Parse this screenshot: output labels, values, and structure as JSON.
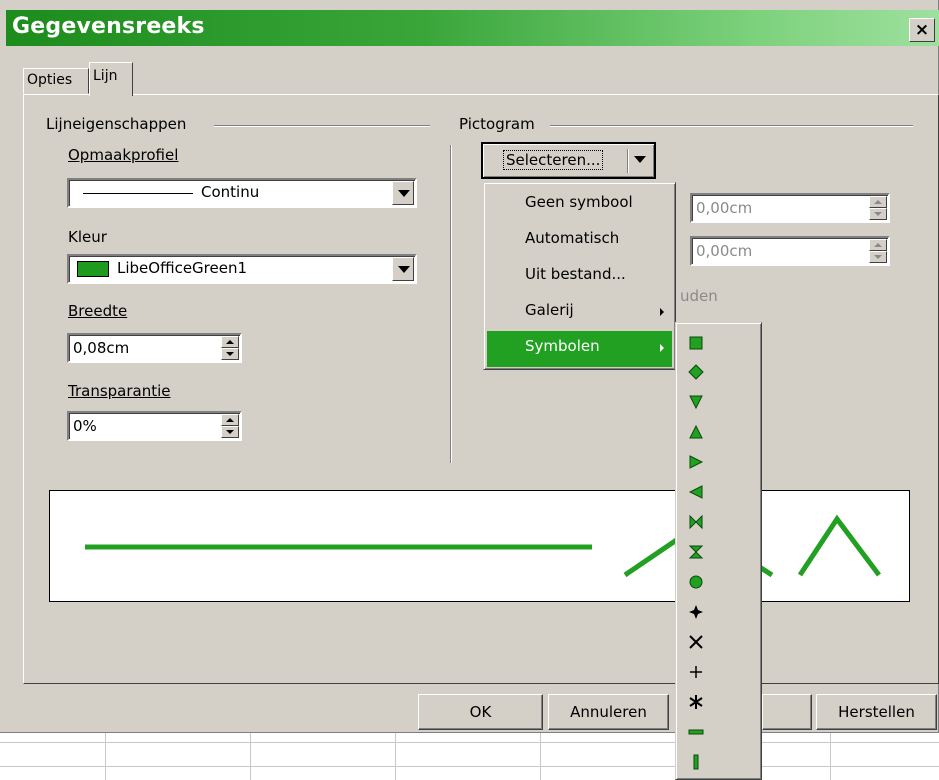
{
  "window": {
    "title": "Gegevensreeks",
    "close_glyph": "×"
  },
  "tabs": [
    {
      "label": "Opties"
    },
    {
      "label": "Lijn",
      "active": true
    }
  ],
  "line_properties": {
    "group_label": "Lijneigenschappen",
    "style": {
      "label": "Opmaakprofiel",
      "value": "Continu"
    },
    "color": {
      "label": "Kleur",
      "value": "LibeOfficeGreen1",
      "swatch": "#1e9a1e"
    },
    "width": {
      "label": "Breedte",
      "value": "0,08cm"
    },
    "transparency": {
      "label": "Transparantie",
      "value": "0%"
    }
  },
  "icon_group": {
    "group_label": "Pictogram",
    "select_button": "Selecteren...",
    "width_value": "0,00cm",
    "height_value": "0,00cm",
    "keep_ratio_partial": "uden"
  },
  "popup_menu": {
    "items": [
      {
        "label": "Geen symbool"
      },
      {
        "label": "Automatisch"
      },
      {
        "label": "Uit bestand..."
      },
      {
        "label": "Galerij",
        "submenu": true
      },
      {
        "label": "Symbolen",
        "submenu": true,
        "selected": true
      }
    ]
  },
  "symbols": [
    "square",
    "diamond",
    "triangle-down",
    "triangle-up",
    "triangle-right",
    "triangle-left",
    "bowtie",
    "hourglass",
    "circle",
    "star-4",
    "x-cross",
    "plus",
    "asterisk",
    "horizontal-bar",
    "vertical-bar"
  ],
  "buttons": {
    "ok": "OK",
    "cancel": "Annuleren",
    "reset": "Herstellen"
  },
  "colors": {
    "accent": "#22a022",
    "line_green": "#22a022",
    "dialog_bg": "#d4d0c8"
  }
}
